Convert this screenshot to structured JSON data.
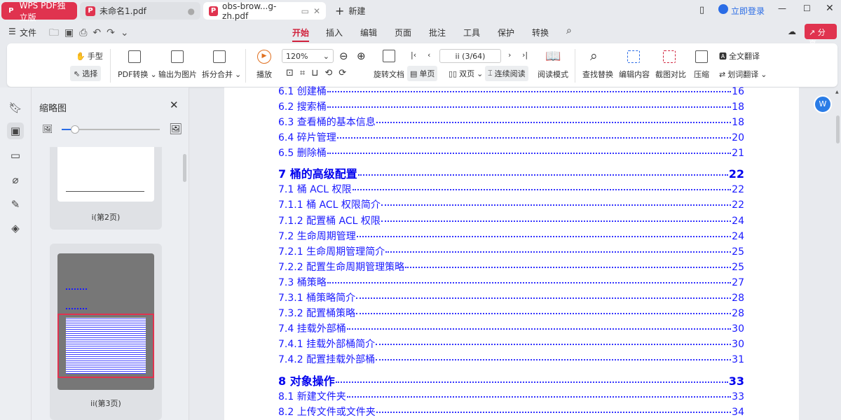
{
  "tabs": [
    {
      "label": "WPS PDF独立版"
    },
    {
      "label": "未命名1.pdf"
    },
    {
      "label": "obs-brow...g-zh.pdf"
    }
  ],
  "new_tab": "新建",
  "login": "立即登录",
  "menu": {
    "file": "文件",
    "tabs": [
      "开始",
      "插入",
      "编辑",
      "页面",
      "批注",
      "工具",
      "保护",
      "转换"
    ],
    "active": "开始",
    "share": "分享"
  },
  "ribbon": {
    "hand": "手型",
    "select": "选择",
    "pdf_convert": "PDF转换",
    "export_image": "输出为图片",
    "split_merge": "拆分合并",
    "play": "播放",
    "zoom": "120%",
    "rotate": "旋转文档",
    "page_indicator": "ii (3/64)",
    "single": "单页",
    "double": "双页",
    "continuous": "连续阅读",
    "read_mode": "阅读模式",
    "find_replace": "查找替换",
    "edit_content": "编辑内容",
    "screenshot_compare": "截图对比",
    "compress": "压缩",
    "full_translate": "全文翻译",
    "word_translate": "划词翻译"
  },
  "thumbs": {
    "title": "缩略图",
    "slider_value": 0.1,
    "pages": [
      {
        "label": "i(第2页)"
      },
      {
        "label": "ii(第3页)"
      }
    ]
  },
  "toc": [
    {
      "t": "6.1 创建桶",
      "p": "16"
    },
    {
      "t": "6.2 搜索桶",
      "p": "18"
    },
    {
      "t": "6.3 查看桶的基本信息",
      "p": "18"
    },
    {
      "t": "6.4 碎片管理",
      "p": "20"
    },
    {
      "t": "6.5 删除桶",
      "p": "21"
    },
    {
      "t": "7 桶的高级配置",
      "p": "22",
      "bold": true
    },
    {
      "t": "7.1 桶 ACL 权限",
      "p": "22"
    },
    {
      "t": "7.1.1 桶 ACL 权限简介",
      "p": "22"
    },
    {
      "t": "7.1.2 配置桶 ACL 权限",
      "p": "24"
    },
    {
      "t": "7.2 生命周期管理",
      "p": "24"
    },
    {
      "t": "7.2.1 生命周期管理简介",
      "p": "25"
    },
    {
      "t": "7.2.2 配置生命周期管理策略",
      "p": "25"
    },
    {
      "t": "7.3 桶策略",
      "p": "27"
    },
    {
      "t": "7.3.1 桶策略简介",
      "p": "28"
    },
    {
      "t": "7.3.2 配置桶策略",
      "p": "28"
    },
    {
      "t": "7.4 挂载外部桶",
      "p": "30"
    },
    {
      "t": "7.4.1 挂载外部桶简介",
      "p": "30"
    },
    {
      "t": "7.4.2 配置挂载外部桶",
      "p": "31"
    },
    {
      "t": "8 对象操作",
      "p": "33",
      "bold": true
    },
    {
      "t": "8.1 新建文件夹",
      "p": "33"
    },
    {
      "t": "8.2 上传文件或文件夹",
      "p": "34"
    }
  ]
}
